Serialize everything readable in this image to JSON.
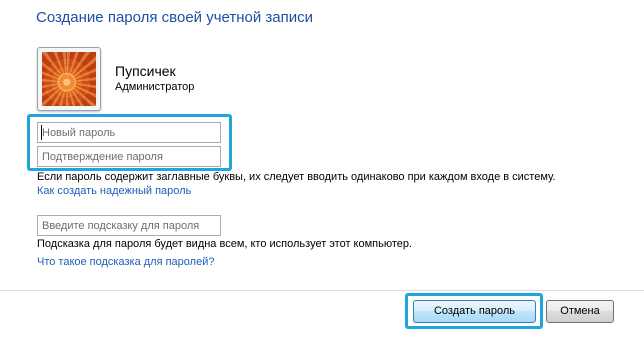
{
  "dialog": {
    "title": "Создание пароля своей учетной записи"
  },
  "user": {
    "name": "Пупсичек",
    "role": "Администратор"
  },
  "fields": {
    "new_password": {
      "value": "",
      "placeholder": "Новый пароль"
    },
    "confirm_password": {
      "value": "",
      "placeholder": "Подтверждение пароля"
    },
    "hint": {
      "value": "",
      "placeholder": "Введите подсказку для пароля"
    }
  },
  "texts": {
    "caps_warning": "Если пароль содержит заглавные буквы, их следует вводить одинаково при каждом входе в систему.",
    "strong_password_link": "Как создать надежный пароль",
    "hint_info": "Подсказка для пароля будет видна всем, кто использует этот компьютер.",
    "hint_link": "Что такое подсказка для паролей?"
  },
  "buttons": {
    "create": "Создать пароль",
    "cancel": "Отмена"
  },
  "colors": {
    "title": "#1e4fa3",
    "link": "#1e5eb8",
    "highlight": "#1ea7dc"
  }
}
